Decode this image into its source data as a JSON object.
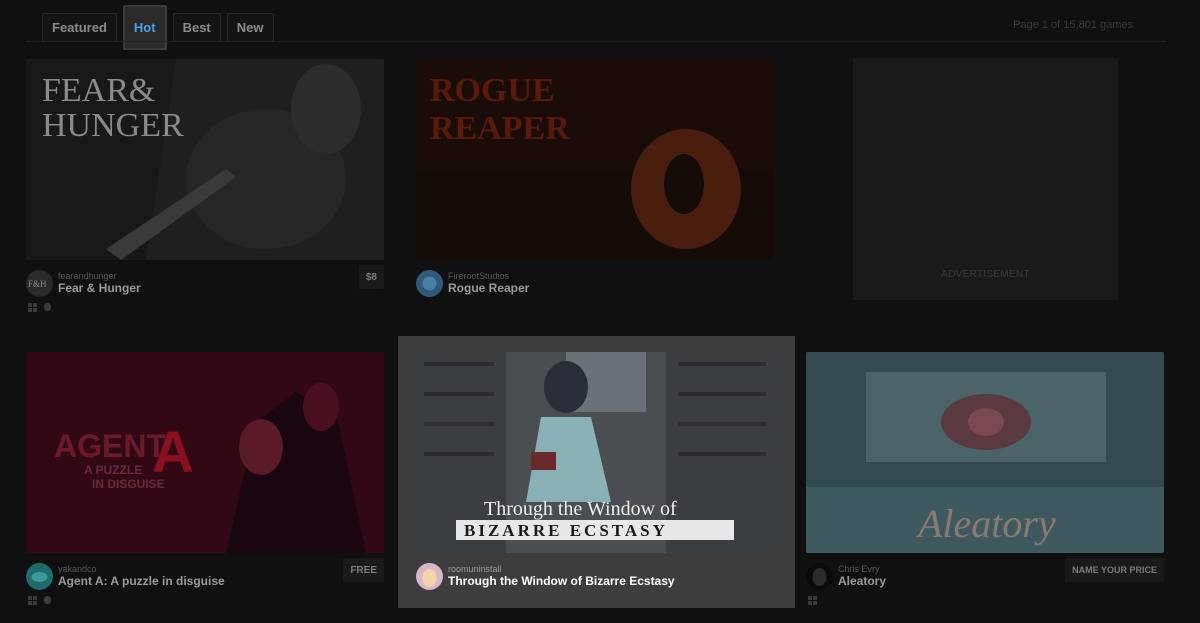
{
  "tabs": [
    {
      "label": "Featured",
      "active": false
    },
    {
      "label": "Hot",
      "active": true
    },
    {
      "label": "Best",
      "active": false
    },
    {
      "label": "New",
      "active": false
    }
  ],
  "pagination": "Page 1 of 15,801 games",
  "advertisement_label": "ADVERTISEMENT",
  "games": [
    {
      "author": "fearandhunger",
      "title": "Fear & Hunger",
      "price": "$8",
      "cover_text": [
        "FEAR&",
        "HUNGER"
      ]
    },
    {
      "author": "FirerootStudios",
      "title": "Rogue Reaper",
      "price": "",
      "cover_text": [
        "ROGUE",
        "REAPER"
      ]
    },
    {
      "author": "yakandco",
      "title": "Agent A: A puzzle in disguise",
      "price": "FREE",
      "cover_text": [
        "AGENT",
        "A",
        "A PUZZLE",
        "IN DISGUISE"
      ]
    },
    {
      "author": "roomuninstall",
      "title": "Through the Window of Bizarre Ecstasy",
      "price": "",
      "cover_text": [
        "Through the Window of",
        "BIZARRE ECSTASY"
      ]
    },
    {
      "author": "Chris Evry",
      "title": "Aleatory",
      "price": "NAME YOUR PRICE",
      "cover_text": [
        "Aleatory"
      ]
    }
  ],
  "colors": {
    "background": "#101010",
    "tab_active": "#4aa3e8",
    "highlight": "#3d3d3d"
  }
}
